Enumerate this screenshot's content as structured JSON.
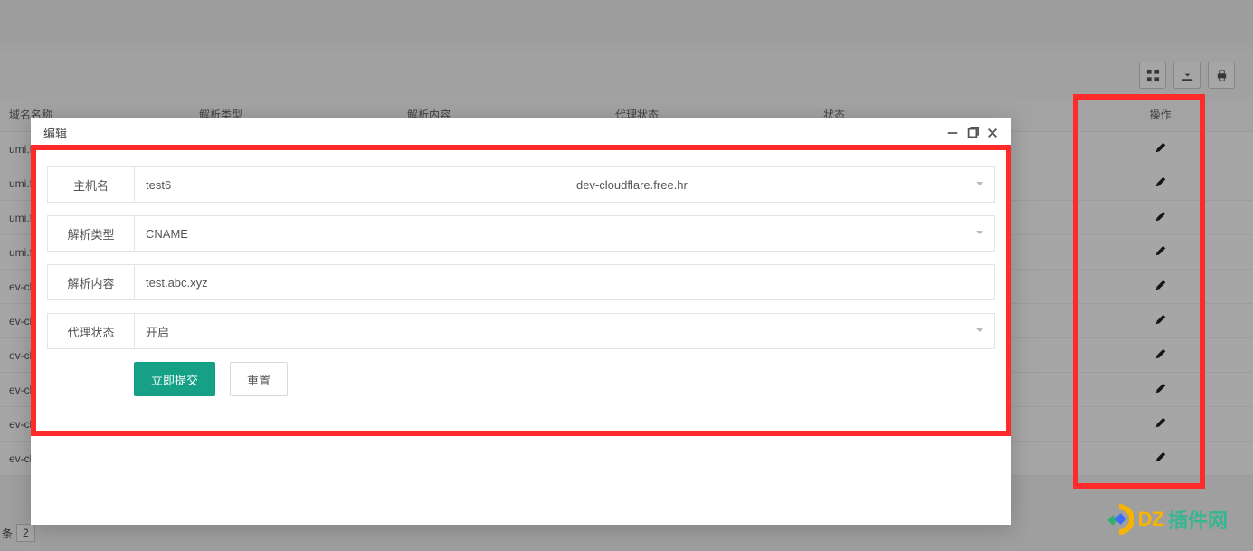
{
  "toolbar": {
    "icons": {
      "columns": "columns-icon",
      "export": "export-icon",
      "print": "print-icon"
    }
  },
  "table": {
    "headers": {
      "name": "域名名称",
      "rtype": "解析类型",
      "content": "解析内容",
      "proxy": "代理状态",
      "status": "状态",
      "action": "操作"
    },
    "rows": [
      {
        "name": "umi.f"
      },
      {
        "name": "umi.f"
      },
      {
        "name": "umi.f"
      },
      {
        "name": "umi.f"
      },
      {
        "name": "ev-cl"
      },
      {
        "name": "ev-cl"
      },
      {
        "name": "ev-cl"
      },
      {
        "name": "ev-cl"
      },
      {
        "name": "ev-cl"
      },
      {
        "name": "ev-cl"
      }
    ],
    "footer": {
      "prefix": "条",
      "page_size": "2"
    }
  },
  "modal": {
    "title": "编辑",
    "labels": {
      "host": "主机名",
      "rtype": "解析类型",
      "content": "解析内容",
      "proxy": "代理状态"
    },
    "values": {
      "host": "test6",
      "domain_suffix": "dev-cloudflare.free.hr",
      "rtype": "CNAME",
      "content": "test.abc.xyz",
      "proxy": "开启"
    },
    "buttons": {
      "submit": "立即提交",
      "reset": "重置"
    }
  },
  "watermark": {
    "dz": "DZ",
    "rest": "插件网"
  },
  "colors": {
    "accent": "#16a085",
    "highlight": "#ff2a2a"
  }
}
